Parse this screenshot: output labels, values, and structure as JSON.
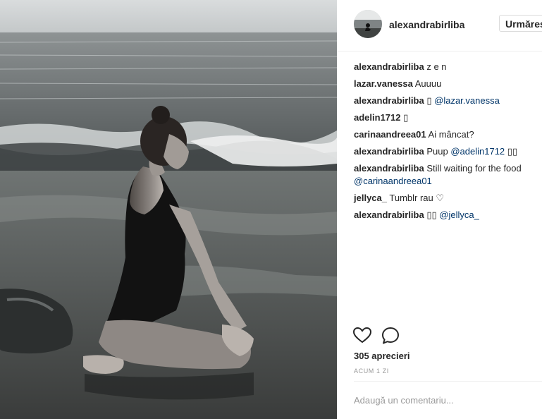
{
  "post": {
    "username": "alexandrabirliba",
    "follow_label": "Urmărește",
    "comments": [
      {
        "user": "alexandrabirliba",
        "text": "z e n",
        "mention": ""
      },
      {
        "user": "lazar.vanessa",
        "text": "Auuuu",
        "mention": ""
      },
      {
        "user": "alexandrabirliba",
        "text": "▯",
        "mention": "@lazar.vanessa"
      },
      {
        "user": "adelin1712",
        "text": "▯",
        "mention": ""
      },
      {
        "user": "carinaandreea01",
        "text": "Ai mâncat?",
        "mention": ""
      },
      {
        "user": "alexandrabirliba",
        "text": "Puup",
        "mention": "@adelin1712",
        "suffix": "▯▯"
      },
      {
        "user": "alexandrabirliba",
        "text": "Still waiting for the food",
        "mention": "@carinaandreea01"
      },
      {
        "user": "jellyca_",
        "text": "Tumblr rau ♡",
        "mention": ""
      },
      {
        "user": "alexandrabirliba",
        "text": "▯▯",
        "mention": "@jellyca_"
      }
    ],
    "likes": "305 aprecieri",
    "time": "ACUM 1 ZI",
    "add_comment_placeholder": "Adaugă un comentariu..."
  },
  "colors": {
    "mention": "#003569",
    "muted": "#999999",
    "border": "#efefef"
  }
}
